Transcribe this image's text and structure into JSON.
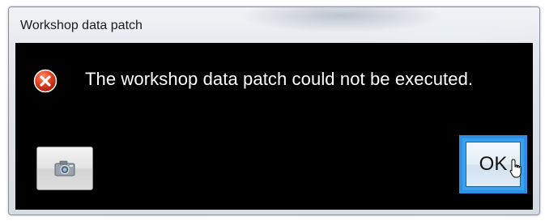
{
  "dialog": {
    "title": "Workshop data patch",
    "message": "The workshop data patch could not be executed.",
    "icon": "error-icon",
    "buttons": {
      "ok_label": "OK",
      "screenshot_icon": "camera-icon"
    }
  },
  "colors": {
    "content_background": "#000000",
    "message_text": "#ffffff",
    "ok_focus_border": "#2f8fe4",
    "error_icon": "#d9341c"
  }
}
